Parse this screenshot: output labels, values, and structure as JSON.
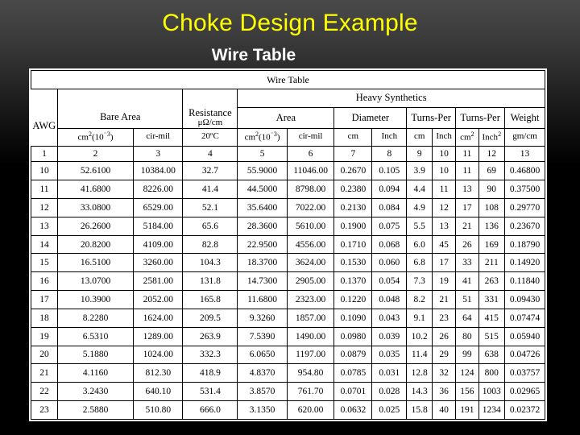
{
  "slide": {
    "title": "Choke Design Example",
    "subtitle": "Wire Table",
    "title_color": "#ffff00",
    "subtitle_color": "#ffffff",
    "background_top_color": "#4a4a4a",
    "background_bottom_color": "#000000"
  },
  "table": {
    "caption": "Wire Table",
    "group_heavy_synthetics": "Heavy Synthetics",
    "group_bare_area": "Bare Area",
    "group_resistance_line1": "Resistance",
    "group_resistance_line2": "μΩ/cm",
    "group_resistance_line3": "20ºC",
    "group_area": "Area",
    "group_diameter": "Diameter",
    "group_turns_per_1": "Turns-Per",
    "group_turns_per_2": "Turns-Per",
    "group_weight": "Weight",
    "unit_headers": [
      "AWG",
      "cm²(10⁻³)",
      "cir-mil",
      "",
      "cm²(10⁻³)",
      "cir-mil",
      "cm",
      "Inch",
      "cm",
      "Inch",
      "cm²",
      "Inch²",
      "gm/cm"
    ],
    "column_numbers": [
      "1",
      "2",
      "3",
      "4",
      "5",
      "6",
      "7",
      "8",
      "9",
      "10",
      "11",
      "12",
      "13"
    ],
    "rows": [
      [
        "10",
        "52.6100",
        "10384.00",
        "32.7",
        "55.9000",
        "11046.00",
        "0.2670",
        "0.105",
        "3.9",
        "10",
        "11",
        "69",
        "0.46800"
      ],
      [
        "11",
        "41.6800",
        "8226.00",
        "41.4",
        "44.5000",
        "8798.00",
        "0.2380",
        "0.094",
        "4.4",
        "11",
        "13",
        "90",
        "0.37500"
      ],
      [
        "12",
        "33.0800",
        "6529.00",
        "52.1",
        "35.6400",
        "7022.00",
        "0.2130",
        "0.084",
        "4.9",
        "12",
        "17",
        "108",
        "0.29770"
      ],
      [
        "13",
        "26.2600",
        "5184.00",
        "65.6",
        "28.3600",
        "5610.00",
        "0.1900",
        "0.075",
        "5.5",
        "13",
        "21",
        "136",
        "0.23670"
      ],
      [
        "14",
        "20.8200",
        "4109.00",
        "82.8",
        "22.9500",
        "4556.00",
        "0.1710",
        "0.068",
        "6.0",
        "45",
        "26",
        "169",
        "0.18790"
      ],
      [
        "15",
        "16.5100",
        "3260.00",
        "104.3",
        "18.3700",
        "3624.00",
        "0.1530",
        "0.060",
        "6.8",
        "17",
        "33",
        "211",
        "0.14920"
      ],
      [
        "16",
        "13.0700",
        "2581.00",
        "131.8",
        "14.7300",
        "2905.00",
        "0.1370",
        "0.054",
        "7.3",
        "19",
        "41",
        "263",
        "0.11840"
      ],
      [
        "17",
        "10.3900",
        "2052.00",
        "165.8",
        "11.6800",
        "2323.00",
        "0.1220",
        "0.048",
        "8.2",
        "21",
        "51",
        "331",
        "0.09430"
      ],
      [
        "18",
        "8.2280",
        "1624.00",
        "209.5",
        "9.3260",
        "1857.00",
        "0.1090",
        "0.043",
        "9.1",
        "23",
        "64",
        "415",
        "0.07474"
      ],
      [
        "19",
        "6.5310",
        "1289.00",
        "263.9",
        "7.5390",
        "1490.00",
        "0.0980",
        "0.039",
        "10.2",
        "26",
        "80",
        "515",
        "0.05940"
      ],
      [
        "20",
        "5.1880",
        "1024.00",
        "332.3",
        "6.0650",
        "1197.00",
        "0.0879",
        "0.035",
        "11.4",
        "29",
        "99",
        "638",
        "0.04726"
      ],
      [
        "21",
        "4.1160",
        "812.30",
        "418.9",
        "4.8370",
        "954.80",
        "0.0785",
        "0.031",
        "12.8",
        "32",
        "124",
        "800",
        "0.03757"
      ],
      [
        "22",
        "3.2430",
        "640.10",
        "531.4",
        "3.8570",
        "761.70",
        "0.0701",
        "0.028",
        "14.3",
        "36",
        "156",
        "1003",
        "0.02965"
      ],
      [
        "23",
        "2.5880",
        "510.80",
        "666.0",
        "3.1350",
        "620.00",
        "0.0632",
        "0.025",
        "15.8",
        "40",
        "191",
        "1234",
        "0.02372"
      ]
    ],
    "separator_before_row_indices": [
      4,
      9
    ]
  }
}
